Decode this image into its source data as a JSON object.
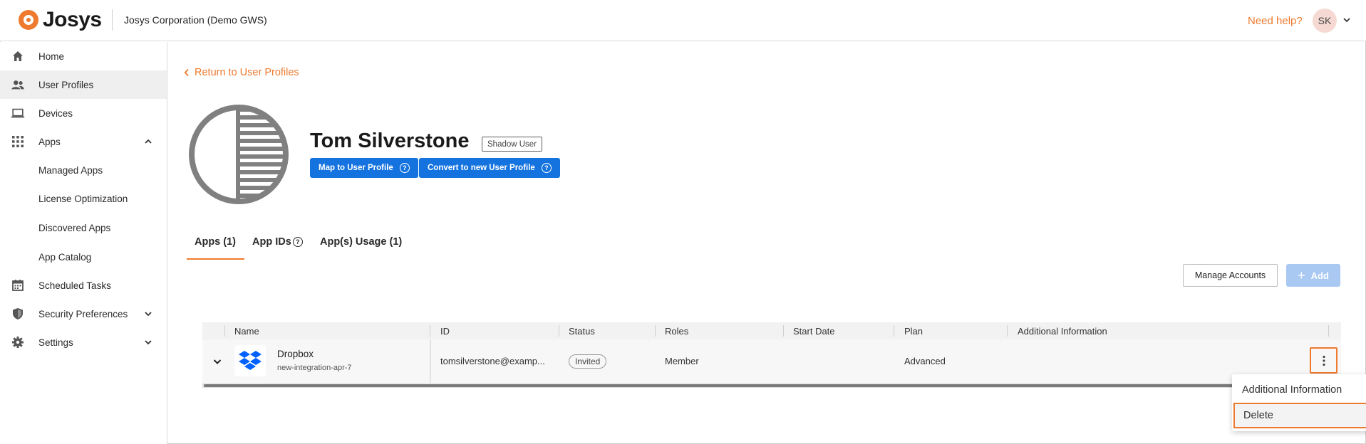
{
  "header": {
    "brand": "Josys",
    "org_name": "Josys Corporation (Demo GWS)",
    "help_link": "Need help?",
    "user_initials": "SK",
    "accent_color": "#ee7a2f"
  },
  "sidebar": {
    "items": [
      {
        "label": "Home",
        "icon": "home-icon"
      },
      {
        "label": "User Profiles",
        "icon": "users-icon",
        "active": true
      },
      {
        "label": "Devices",
        "icon": "laptop-icon"
      },
      {
        "label": "Apps",
        "icon": "grid-icon",
        "expanded": true
      },
      {
        "label": "Managed Apps"
      },
      {
        "label": "License Optimization"
      },
      {
        "label": "Discovered Apps"
      },
      {
        "label": "App Catalog"
      },
      {
        "label": "Scheduled Tasks",
        "icon": "calendar-icon"
      },
      {
        "label": "Security Preferences",
        "icon": "shield-icon"
      },
      {
        "label": "Settings",
        "icon": "gear-icon"
      }
    ]
  },
  "main": {
    "back_link": "Return to User Profiles",
    "user_name": "Tom Silverstone",
    "user_badge": "Shadow User",
    "map_button": "Map to User Profile",
    "convert_button": "Convert to new User Profile",
    "tabs": [
      {
        "label": "Apps (1)",
        "active": true
      },
      {
        "label": "App IDs"
      },
      {
        "label": "App(s) Usage (1)"
      }
    ],
    "manage_accounts_button": "Manage Accounts",
    "add_button": "Add"
  },
  "table": {
    "columns": [
      "Name",
      "ID",
      "Status",
      "Roles",
      "Start Date",
      "Plan",
      "Additional Information"
    ],
    "rows": [
      {
        "app_name": "Dropbox",
        "integration": "new-integration-apr-7",
        "id": "tomsilverstone@examp...",
        "status": "Invited",
        "roles": "Member",
        "start_date": "",
        "plan": "Advanced",
        "additional_info": ""
      }
    ]
  },
  "row_menu": {
    "items": [
      "Additional Information",
      "Delete"
    ],
    "highlighted": "Delete"
  }
}
